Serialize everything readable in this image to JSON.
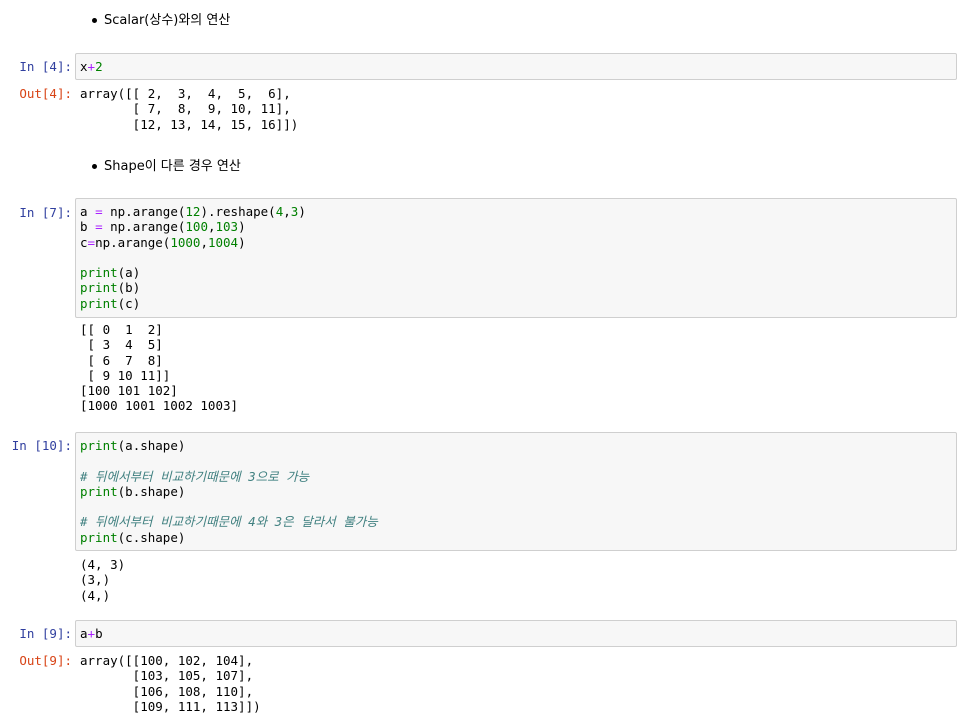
{
  "markdown": {
    "scalar": "Scalar(상수)와의 연산",
    "shape": "Shape이 다른 경우 연산"
  },
  "cells": {
    "c4": {
      "in_prompt": "In [4]:",
      "out_prompt": "Out[4]:",
      "code": {
        "x": "x",
        "op": "+",
        "n": "2"
      },
      "output": "array([[ 2,  3,  4,  5,  6],\n       [ 7,  8,  9, 10, 11],\n       [12, 13, 14, 15, 16]])"
    },
    "c7": {
      "in_prompt": "In [7]:",
      "code_lines": {
        "l1a": "a ",
        "l1b": "=",
        "l1c": " np.arange(",
        "l1d": "12",
        "l1e": ").reshape(",
        "l1f": "4",
        "l1g": ",",
        "l1h": "3",
        "l1i": ")",
        "l2a": "b ",
        "l2b": "=",
        "l2c": " np.arange(",
        "l2d": "100",
        "l2e": ",",
        "l2f": "103",
        "l2g": ")",
        "l3a": "c",
        "l3b": "=",
        "l3c": "np.arange(",
        "l3d": "1000",
        "l3e": ",",
        "l3f": "1004",
        "l3g": ")",
        "print": "print",
        "pa": "(a)",
        "pb": "(b)",
        "pc": "(c)"
      },
      "output": "[[ 0  1  2]\n [ 3  4  5]\n [ 6  7  8]\n [ 9 10 11]]\n[100 101 102]\n[1000 1001 1002 1003]"
    },
    "c10": {
      "in_prompt": "In [10]:",
      "print": "print",
      "l1": "(a.shape)",
      "comment1": "# 뒤에서부터 비교하기때문에 3으로 가능",
      "l2": "(b.shape)",
      "comment2": "# 뒤에서부터 비교하기때문에 4와 3은 달라서 불가능",
      "l3": "(c.shape)",
      "output": "(4, 3)\n(3,)\n(4,)"
    },
    "c9": {
      "in_prompt": "In [9]:",
      "out_prompt": "Out[9]:",
      "code": {
        "a": "a",
        "op": "+",
        "b": "b"
      },
      "output": "array([[100, 102, 104],\n       [103, 105, 107],\n       [106, 108, 110],\n       [109, 111, 113]])"
    }
  }
}
